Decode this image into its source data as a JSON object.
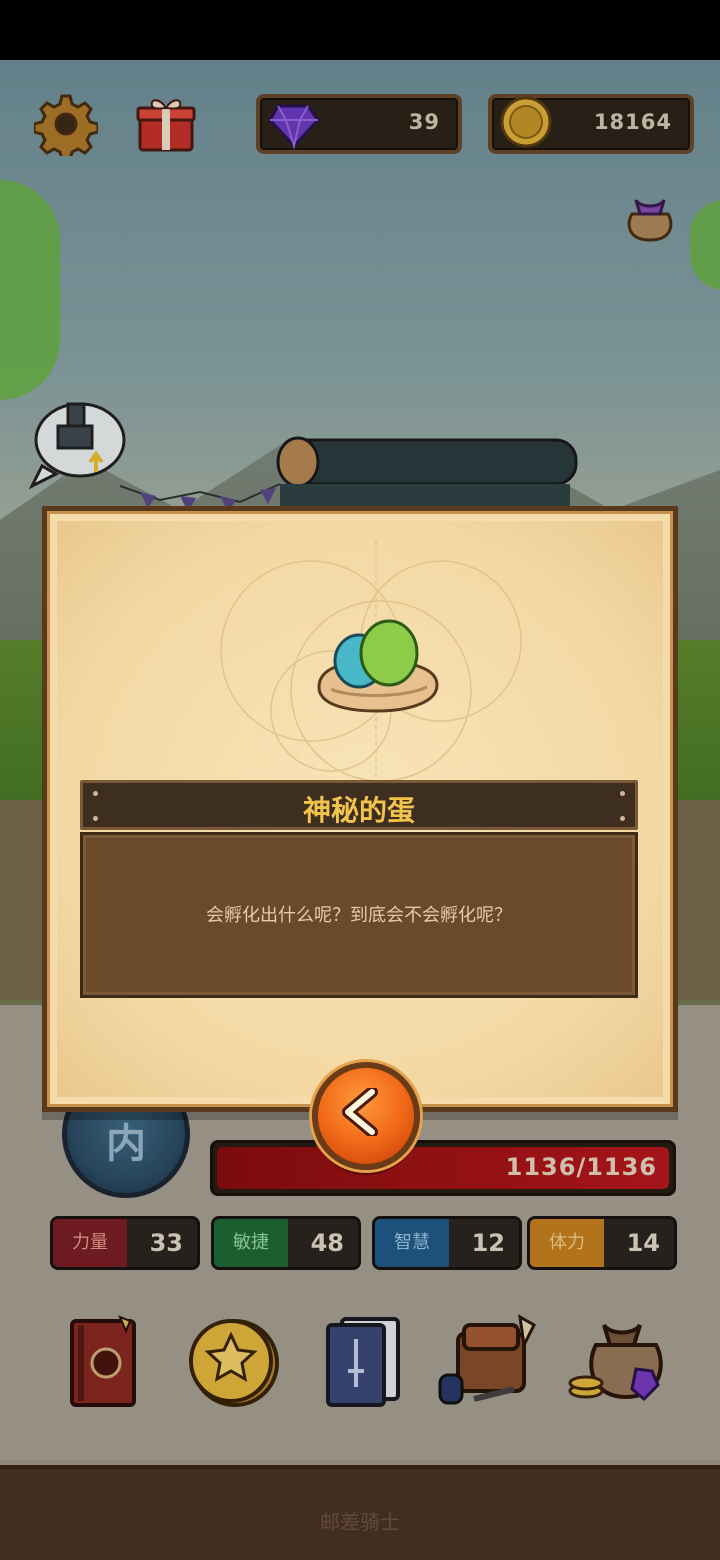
{
  "hud": {
    "gems": "39",
    "coins": "18164",
    "icons": [
      "gear-icon",
      "gift-icon",
      "gem-icon",
      "coin-icon",
      "pouch-icon",
      "upgrade-anvil-icon"
    ]
  },
  "character": {
    "emblem_glyph": "内",
    "hp": "1136/1136",
    "stats": [
      {
        "label": "力量",
        "value": "33",
        "color": "#7a1e24"
      },
      {
        "label": "敏捷",
        "value": "48",
        "color": "#1f6a37"
      },
      {
        "label": "智慧",
        "value": "12",
        "color": "#1f5b8a"
      },
      {
        "label": "体力",
        "value": "14",
        "color": "#c7801f"
      }
    ],
    "menu_icons": [
      "spellbook-icon",
      "star-coin-icon",
      "card-deck-icon",
      "backpack-icon",
      "treasure-bag-icon"
    ]
  },
  "modal": {
    "item_name": "神秘的蛋",
    "item_description": "会孵化出什么呢？到底会不会孵化呢？",
    "back_icon": "chevron-left-icon"
  },
  "footer": {
    "title": "邮差骑士"
  },
  "colors": {
    "title_gold": "#f3c34b",
    "modal_parchment": "#f5dcaa",
    "back_button": "#f26a18",
    "hp_red": "#b8181c"
  }
}
